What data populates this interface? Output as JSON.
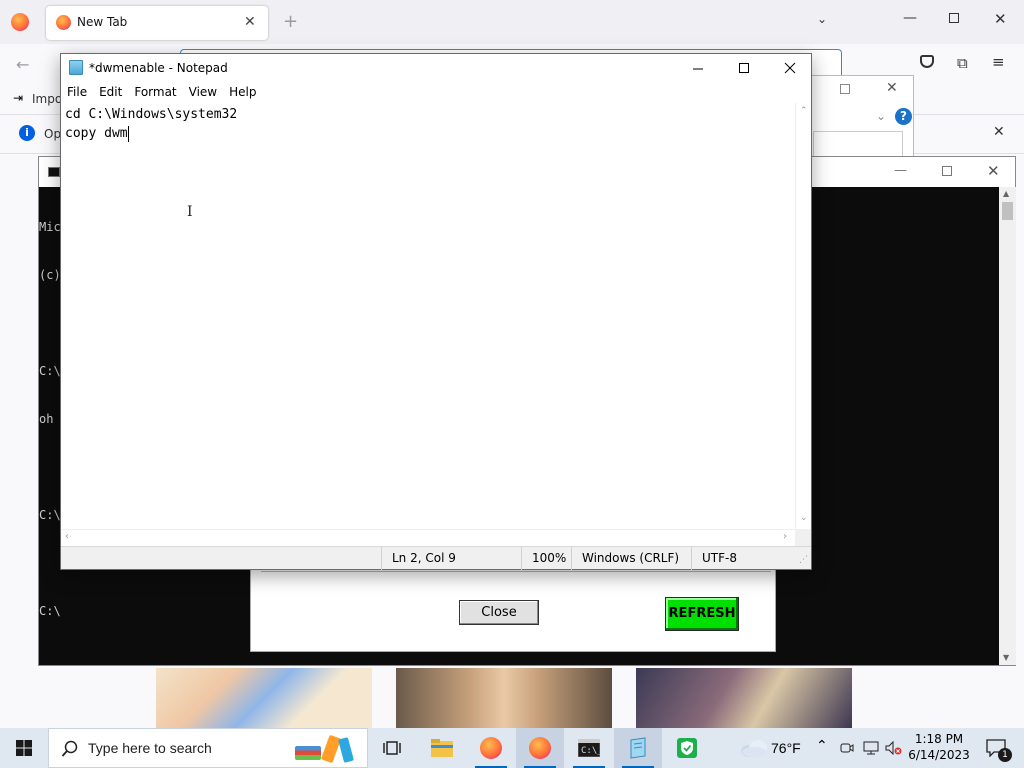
{
  "firefox": {
    "tab_title": "New Tab",
    "bookmark_partial": "Impo",
    "notice_partial": "Op"
  },
  "cmd": {
    "lines": [
      "Mic",
      "(c)",
      "",
      "C:\\",
      "oh",
      "",
      "C:\\",
      "",
      "C:\\"
    ]
  },
  "refresh_dialog": {
    "close_label": "Close",
    "refresh_label": "REFRESH",
    "refresh_color": "#00e000"
  },
  "notepad": {
    "title": "*dwmenable - Notepad",
    "menu": [
      "File",
      "Edit",
      "Format",
      "View",
      "Help"
    ],
    "content_lines": [
      "cd C:\\Windows\\system32",
      "copy dwm"
    ],
    "status": {
      "position": "Ln 2, Col 9",
      "zoom": "100%",
      "line_ending": "Windows (CRLF)",
      "encoding": "UTF-8"
    }
  },
  "taskbar": {
    "search_placeholder": "Type here to search",
    "weather": "76°F",
    "time": "1:18 PM",
    "date": "6/14/2023",
    "notification_count": "1",
    "icons": [
      "windows-start-icon",
      "task-view-icon",
      "file-explorer-icon",
      "firefox-icon",
      "firefox-active-icon",
      "terminal-icon",
      "notepad-icon",
      "security-shield-icon"
    ]
  },
  "colors": {
    "accent": "#0067c0",
    "taskbar_bg": "#dfe7f1",
    "console_bg": "#0c0c0c"
  }
}
